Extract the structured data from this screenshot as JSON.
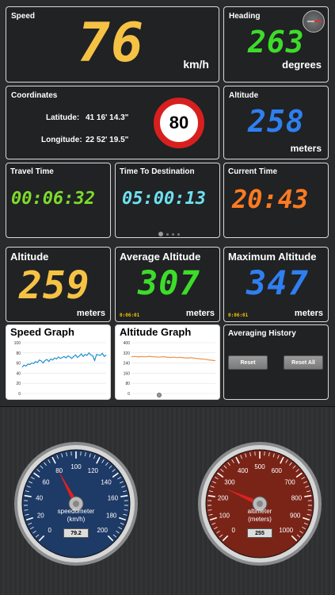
{
  "speed": {
    "label": "Speed",
    "value": "76",
    "unit": "km/h"
  },
  "heading": {
    "label": "Heading",
    "value": "263",
    "unit": "degrees"
  },
  "coordinates": {
    "label": "Coordinates",
    "lat_label": "Latitude:",
    "lat_value": "41 16' 14.3\"",
    "lon_label": "Longitude:",
    "lon_value": "22 52' 19.5\"",
    "speed_limit": "80"
  },
  "altitude_top": {
    "label": "Altitude",
    "value": "258",
    "unit": "meters"
  },
  "travel_time": {
    "label": "Travel Time",
    "value": "00:06:32"
  },
  "time_to_destination": {
    "label": "Time To Destination",
    "value": "05:00:13"
  },
  "current_time": {
    "label": "Current Time",
    "value": "20:43"
  },
  "altitude": {
    "label": "Altitude",
    "value": "259",
    "unit": "meters"
  },
  "average_altitude": {
    "label": "Average Altitude",
    "value": "307",
    "unit": "meters",
    "timestamp": "0:06:01"
  },
  "maximum_altitude": {
    "label": "Maximum Altitude",
    "value": "347",
    "unit": "meters",
    "timestamp": "0:06:01"
  },
  "speed_graph": {
    "title": "Speed Graph",
    "y_ticks": [
      "100",
      "80",
      "60",
      "40",
      "20",
      "0"
    ],
    "chart_data": {
      "type": "line",
      "ylim": [
        0,
        100
      ],
      "values": [
        52,
        56,
        54,
        58,
        57,
        60,
        59,
        63,
        61,
        66,
        64,
        60,
        65,
        67,
        63,
        68,
        66,
        70,
        68,
        72,
        69,
        71,
        73,
        70,
        74,
        72,
        69,
        73,
        76,
        71,
        74,
        78,
        73,
        77,
        75,
        80,
        76,
        74,
        65,
        77,
        76,
        75,
        79,
        73,
        76
      ]
    }
  },
  "altitude_graph": {
    "title": "Altitude Graph",
    "y_ticks": [
      "400",
      "320",
      "240",
      "160",
      "80",
      "0"
    ],
    "chart_data": {
      "type": "line",
      "ylim": [
        0,
        400
      ],
      "values": [
        290,
        292,
        288,
        291,
        289,
        293,
        290,
        288,
        286,
        290,
        287,
        284,
        286,
        283,
        285,
        281,
        279,
        282,
        278,
        275,
        272,
        270,
        265,
        262,
        259
      ]
    }
  },
  "averaging_history": {
    "label": "Averaging History",
    "reset": "Reset",
    "reset_all": "Reset All"
  },
  "speedometer": {
    "label_line1": "speedometer",
    "label_line2": "(km/h)",
    "ticks": [
      "0",
      "20",
      "40",
      "60",
      "80",
      "100",
      "120",
      "140",
      "160",
      "180",
      "200"
    ],
    "max": 200,
    "needle_value": 79.2,
    "readout": "79.2"
  },
  "altimeter": {
    "label_line1": "altimeter",
    "label_line2": "(meters)",
    "ticks": [
      "0",
      "100",
      "200",
      "300",
      "400",
      "500",
      "600",
      "700",
      "800",
      "900",
      "1000"
    ],
    "max": 1000,
    "needle_value": 255,
    "readout": "255"
  },
  "colors": {
    "speed": "#f6c244",
    "heading": "#3ddc2a",
    "altitude_top": "#2f7ff0",
    "travel_time": "#7ddc2a",
    "time_to_destination": "#6fe0f0",
    "current_time": "#ff7a22",
    "altitude": "#f6c244",
    "average_altitude": "#3ddc2a",
    "maximum_altitude": "#2f7ff0",
    "speed_line": "#1f8fcf",
    "altitude_line": "#e8964a",
    "speedo_face": "#1e3a66",
    "alti_face": "#7a2418",
    "needle": "#e02020"
  },
  "icons": {
    "compass": "compass-icon",
    "page_dots": "page-indicator"
  }
}
